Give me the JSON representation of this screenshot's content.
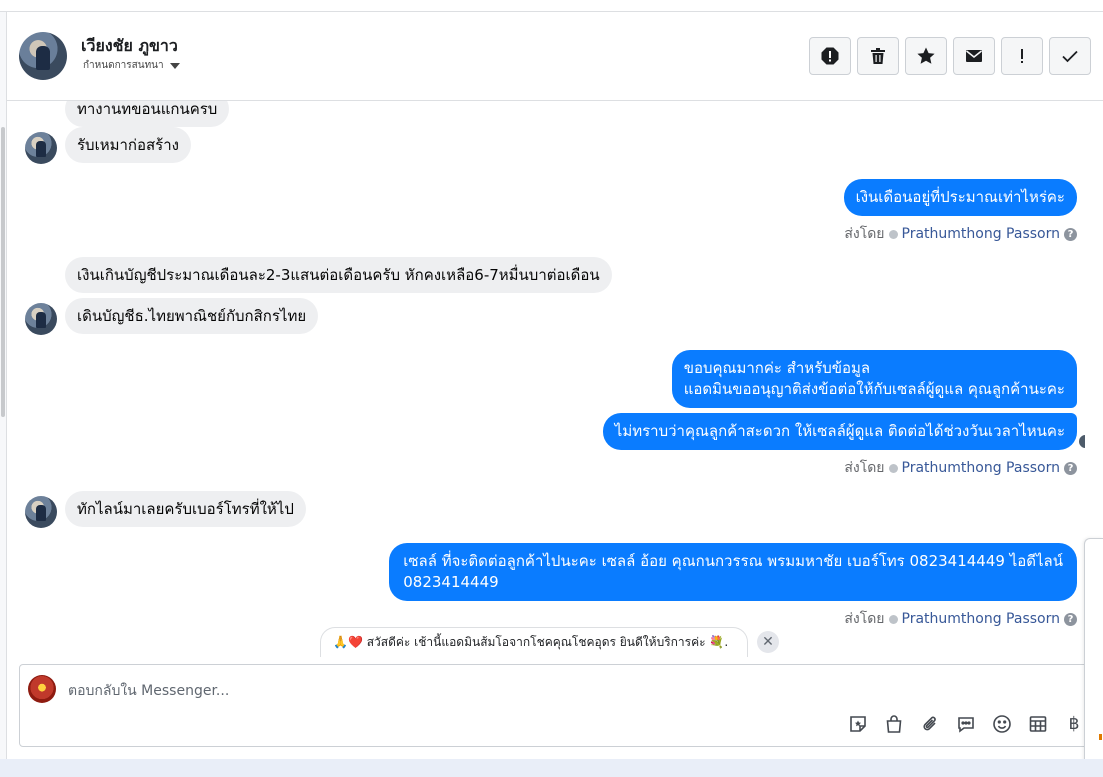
{
  "header": {
    "name": "เวียงชัย ภูขาว",
    "subtitle": "กำหนดการสนทนา",
    "actions": [
      {
        "name": "spam-icon"
      },
      {
        "name": "trash-icon"
      },
      {
        "name": "star-icon"
      },
      {
        "name": "mail-icon"
      },
      {
        "name": "exclamation-icon"
      },
      {
        "name": "check-icon"
      }
    ]
  },
  "messages": {
    "in1": "ทางานทขอนแกนครบ",
    "in2": "รับเหมาก่อสร้าง",
    "out1": "เงินเดือนอยู่ที่ประมาณเท่าไหร่คะ",
    "in3": "เงินเกินบัญชีประมาณเดือนละ2-3แสนต่อเดือนครับ หักคงเหลือ6-7หมื่นบาต่อเดือน",
    "in4": "เดินบัญชีธ.ไทยพาณิชย์กับกสิกรไทย",
    "out2_line1": "ขอบคุณมากค่ะ สำหรับข้อมูล",
    "out2_line2": "แอดมินขออนุญาติส่งข้อต่อให้กับเซลล์ผู้ดูแล คุณลูกค้านะคะ",
    "out3": "ไม่ทราบว่าคุณลูกค้าสะดวก ให้เซลล์ผู้ดูแล ติดต่อได้ช่วงวันเวลาไหนคะ",
    "in5": "ทักไลน์มาเลยครับเบอร์โทรที่ให้ไป",
    "out4_line1": "เซลล์ ที่จะติดต่อลูกค้าไปนะคะ เซลล์ อ้อย คุณกนกวรรณ พรมมหาชัย เบอร์โทร 0823414449 ไอดีไลน์",
    "out4_line2": "0823414449"
  },
  "sent_by": {
    "prefix": "ส่งโดย",
    "name": "Prathumthong Passorn"
  },
  "quick_reply": {
    "text": "🙏❤️ สวัสดีค่ะ เช้านี้แอดมินส้มโอจากโชคคุณโชคอุดร ยินดีให้บริการค่ะ 💐."
  },
  "composer": {
    "placeholder": "ตอบกลับใน Messenger...",
    "tools": [
      "sticker-icon",
      "bag-icon",
      "attachment-icon",
      "saved-reply-icon",
      "emoji-icon",
      "table-icon",
      "baht-icon"
    ]
  }
}
